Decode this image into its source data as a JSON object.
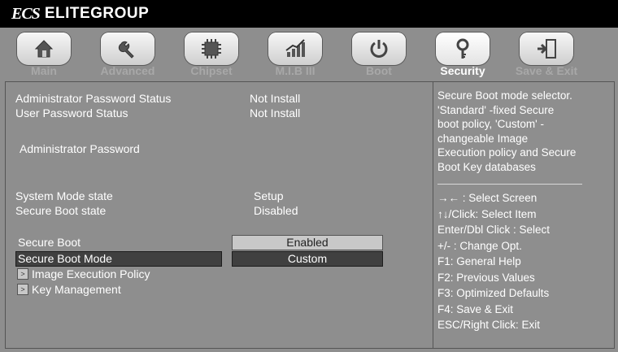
{
  "brand": {
    "logo_text": "ECS",
    "name": "ELITEGROUP"
  },
  "tabs": [
    {
      "label": "Main",
      "icon": "home-icon"
    },
    {
      "label": "Advanced",
      "icon": "wrench-icon"
    },
    {
      "label": "Chipset",
      "icon": "chip-icon"
    },
    {
      "label": "M.I.B III",
      "icon": "chart-icon"
    },
    {
      "label": "Boot",
      "icon": "power-icon"
    },
    {
      "label": "Security",
      "icon": "key-icon",
      "active": true
    },
    {
      "label": "Save & Exit",
      "icon": "exit-icon"
    }
  ],
  "settings": {
    "admin_pw_status_label": "Administrator Password Status",
    "admin_pw_status_value": "Not Install",
    "user_pw_status_label": "User Password Status",
    "user_pw_status_value": "Not Install",
    "admin_password_label": "Administrator  Password",
    "system_mode_label": "System Mode state",
    "system_mode_value": "Setup",
    "secure_boot_state_label": "Secure Boot state",
    "secure_boot_state_value": "Disabled",
    "secure_boot_label": "Secure Boot",
    "secure_boot_value": "Enabled",
    "secure_boot_mode_label": "Secure Boot Mode",
    "secure_boot_mode_value": "Custom",
    "image_exec_label": "Image Execution Policy",
    "key_mgmt_label": "Key Management"
  },
  "help": {
    "description_lines": [
      "Secure Boot mode selector.",
      "'Standard' -fixed Secure",
      "boot policy, 'Custom' -",
      "changeable Image",
      "Execution policy and Secure",
      "Boot Key databases"
    ],
    "keys": [
      "→←  : Select Screen",
      "↑↓/Click: Select Item",
      "Enter/Dbl Click : Select",
      "+/- : Change Opt.",
      "F1: General Help",
      "F2: Previous Values",
      "F3: Optimized Defaults",
      "F4: Save & Exit",
      "ESC/Right Click: Exit"
    ]
  },
  "colors": {
    "background": "#8e8e8e",
    "topbar": "#000000",
    "highlight": "#404040",
    "text": "#ffffff",
    "inactive_tab": "#a8a8a8"
  }
}
